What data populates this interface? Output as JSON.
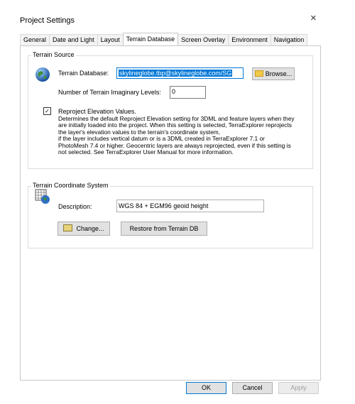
{
  "dialog": {
    "title": "Project Settings",
    "close_glyph": "×"
  },
  "tabs": [
    {
      "label": "General"
    },
    {
      "label": "Date and Light"
    },
    {
      "label": "Layout"
    },
    {
      "label": "Terrain Database"
    },
    {
      "label": "Screen Overlay"
    },
    {
      "label": "Environment"
    },
    {
      "label": "Navigation"
    }
  ],
  "terrain_source": {
    "legend": "Terrain Source",
    "database_label": "Terrain Database:",
    "database_value": "skylineglobe.tbp@skylineglobe.com/SG",
    "browse_label": "Browse...",
    "levels_label": "Number of Terrain Imaginary Levels:",
    "levels_value": "0",
    "reproject_label": "Reproject Elevation Values.",
    "reproject_checked": true,
    "reproject_desc_lines": [
      "Determines the default Reproject Elevation setting for 3DML and feature layers when they",
      "are initially loaded into the project. When this setting is selected, TerraExplorer reprojects",
      "the layer's elevation values to the terrain's coordinate system,",
      "if the layer includes vertical datum or is a 3DML created in TerraExplorer 7.1 or",
      "PhotoMesh 7.4 or higher. Geocentric layers are always reprojected, even if this setting is",
      "not selected. See TerraExplorer User Manual for more information."
    ]
  },
  "terrain_cs": {
    "legend": "Terrain Coordinate System",
    "description_label": "Description:",
    "description_value": "WGS 84 + EGM96 geoid height",
    "change_label": "Change...",
    "restore_label": "Restore from Terrain DB"
  },
  "footer": {
    "ok": "OK",
    "cancel": "Cancel",
    "apply": "Apply"
  },
  "colors": {
    "accent": "#0078d7",
    "folder": "#f3c94a"
  }
}
